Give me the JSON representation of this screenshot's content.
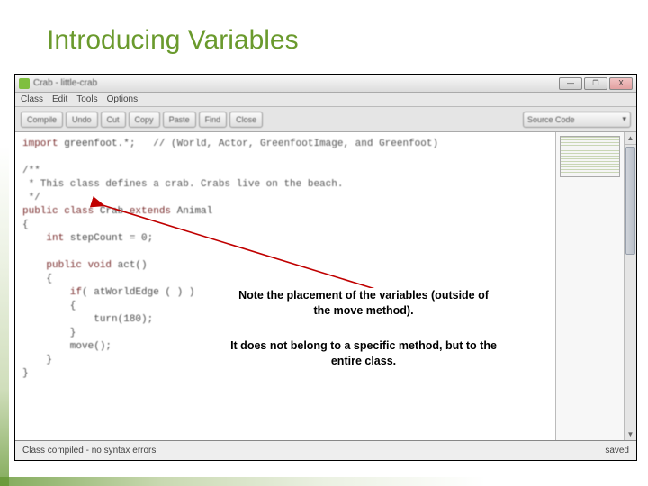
{
  "slide": {
    "title": "Introducing Variables"
  },
  "window": {
    "title": "Crab - little-crab",
    "controls": {
      "min": "—",
      "max": "❐",
      "close": "X"
    }
  },
  "menu": {
    "class": "Class",
    "edit": "Edit",
    "tools": "Tools",
    "options": "Options"
  },
  "toolbar": {
    "compile": "Compile",
    "undo": "Undo",
    "cut": "Cut",
    "copy": "Copy",
    "paste": "Paste",
    "find": "Find",
    "close": "Close",
    "source": "Source Code",
    "dropdown_icon": "▾"
  },
  "code": {
    "line1_a": "import",
    "line1_b": " greenfoot.*;   ",
    "line1_c": "// (World, Actor, GreenfootImage, and Greenfoot)",
    "line2": "",
    "line3": "/**",
    "line4": " * This class defines a crab. Crabs live on the beach.",
    "line5": " */",
    "line6_a": "public class",
    "line6_b": " Crab ",
    "line6_c": "extends",
    "line6_d": " Animal",
    "line7": "{",
    "line8_a": "    int",
    "line8_b": " stepCount = 0;",
    "line9": "",
    "line10_a": "    public void",
    "line10_b": " act()",
    "line11": "    {",
    "line12_a": "        if",
    "line12_b": "( atWorldEdge ( ) )",
    "line13": "        {",
    "line14": "            turn(180);",
    "line15": "        }",
    "line16": "        move();",
    "line17": "    }",
    "line18": "}"
  },
  "status": {
    "left": "Class compiled - no syntax errors",
    "right": "saved"
  },
  "notes": {
    "n1": "Note the placement of the variables (outside of the move method).",
    "n2": "It does not belong to a specific method, but to the entire class."
  },
  "scroll": {
    "up": "▲",
    "down": "▼"
  }
}
